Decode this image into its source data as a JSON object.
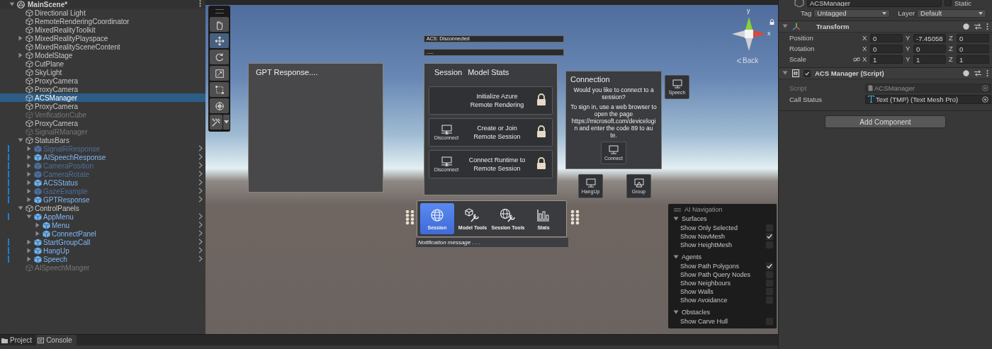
{
  "hierarchy": {
    "scene": {
      "label": "MainScene*",
      "expanded": true
    },
    "items": [
      {
        "label": "Directional Light",
        "kind": "object",
        "disabled": false,
        "selected": false
      },
      {
        "label": "RemoteRenderingCoordinator",
        "kind": "object",
        "disabled": false,
        "selected": false
      },
      {
        "label": "MixedRealityToolkit",
        "kind": "object",
        "disabled": false,
        "selected": false
      },
      {
        "label": "MixedRealityPlayspace",
        "kind": "object",
        "disabled": false,
        "selected": false,
        "expanded": false
      },
      {
        "label": "MixedRealitySceneContent",
        "kind": "object",
        "disabled": false,
        "selected": false
      },
      {
        "label": "ModelStage",
        "kind": "object",
        "disabled": false,
        "selected": false,
        "expanded": false
      },
      {
        "label": "CutPlane",
        "kind": "object",
        "disabled": false,
        "selected": false
      },
      {
        "label": "SkyLight",
        "kind": "object",
        "disabled": false,
        "selected": false
      },
      {
        "label": "ProxyCamera",
        "kind": "object",
        "disabled": false,
        "selected": false
      },
      {
        "label": "ProxyCamera",
        "kind": "object",
        "disabled": false,
        "selected": false
      },
      {
        "label": "ACSManager",
        "kind": "object",
        "disabled": false,
        "selected": true
      },
      {
        "label": "ProxyCamera",
        "kind": "object",
        "disabled": false,
        "selected": false
      },
      {
        "label": "VerificationCube",
        "kind": "object",
        "disabled": true,
        "selected": false
      },
      {
        "label": "ProxyCamera",
        "kind": "object",
        "disabled": false,
        "selected": false
      },
      {
        "label": "SignalRManager",
        "kind": "object",
        "disabled": true,
        "selected": false
      },
      {
        "label": "StatusBars",
        "kind": "object",
        "disabled": false,
        "selected": false,
        "expanded": true,
        "children": [
          {
            "label": "SignalRResponse",
            "kind": "prefab",
            "override": true,
            "disabled": true,
            "selected": false,
            "expanded": false
          },
          {
            "label": "AISpeechResponse",
            "kind": "prefab",
            "override": true,
            "disabled": false,
            "selected": false,
            "expanded": false
          },
          {
            "label": "CameraPosition",
            "kind": "prefab",
            "override": true,
            "disabled": true,
            "selected": false,
            "expanded": false
          },
          {
            "label": "CameraRotate",
            "kind": "prefab",
            "override": true,
            "disabled": true,
            "selected": false,
            "expanded": false
          },
          {
            "label": "ACSStatus",
            "kind": "prefab",
            "override": true,
            "disabled": false,
            "selected": false,
            "expanded": false
          },
          {
            "label": "GazeExample",
            "kind": "prefab",
            "override": true,
            "disabled": true,
            "selected": false,
            "expanded": false
          },
          {
            "label": "GPTResponse",
            "kind": "prefab",
            "override": true,
            "disabled": false,
            "selected": false,
            "expanded": false
          }
        ]
      },
      {
        "label": "ControlPanels",
        "kind": "object",
        "disabled": false,
        "selected": false,
        "expanded": true,
        "children": [
          {
            "label": "AppMenu",
            "kind": "prefab",
            "override": true,
            "disabled": false,
            "selected": false,
            "expanded": true,
            "children": [
              {
                "label": "Menu",
                "kind": "prefab",
                "override": false,
                "disabled": false,
                "selected": false,
                "expanded": false
              },
              {
                "label": "ConnectPanel",
                "kind": "prefab",
                "override": false,
                "disabled": false,
                "selected": false,
                "expanded": false
              }
            ]
          },
          {
            "label": "StartGroupCall",
            "kind": "prefab",
            "override": true,
            "disabled": false,
            "selected": false,
            "expanded": false
          },
          {
            "label": "HangUp",
            "kind": "prefab",
            "override": true,
            "disabled": false,
            "selected": false,
            "expanded": false
          },
          {
            "label": "Speech",
            "kind": "prefab",
            "override": true,
            "disabled": false,
            "selected": false,
            "expanded": false
          }
        ]
      },
      {
        "label": "AISpeechManger",
        "kind": "object",
        "disabled": true,
        "selected": false
      }
    ]
  },
  "scene": {
    "tools": [
      {
        "kind": "hand",
        "selected": false
      },
      {
        "kind": "move",
        "selected": true
      },
      {
        "kind": "rotate",
        "selected": false
      },
      {
        "kind": "scale",
        "selected": false
      },
      {
        "kind": "rect",
        "selected": false
      },
      {
        "kind": "transform",
        "selected": false
      },
      {
        "kind": "custom",
        "selected": false
      }
    ],
    "gizmo": {
      "y_label": "y",
      "x_label": "x",
      "back": "Back"
    },
    "status_bars": [
      "ACS: Disconnected",
      "....."
    ],
    "gpt_panel": {
      "title": "GPT Response...."
    },
    "session_panel": {
      "titles": [
        "Session",
        "Model Stats"
      ],
      "buttons": [
        {
          "lines": [
            "Initialize Azure",
            "Remote Rendering"
          ],
          "locked": true
        },
        {
          "lines": [
            "Create or Join",
            "Remote Session"
          ],
          "icon_label": "Disconnect",
          "locked": true
        },
        {
          "lines": [
            "Connect Runtime to",
            "Remote Session"
          ],
          "icon_label": "Disconnect",
          "locked": true
        }
      ]
    },
    "connection_panel": {
      "title": "Connection",
      "prompt": "Would you like to connect to a session?",
      "message": "To sign in, use a web browser to open the page https://microsoft.com/devicelogin and enter the code 89 to au te.",
      "button": "Connect"
    },
    "floating_buttons": [
      {
        "label": "Speech",
        "kind": "monitor"
      },
      {
        "label": "HangUp",
        "kind": "monitor"
      },
      {
        "label": "Group",
        "kind": "monitor-stand"
      }
    ],
    "app_menu": {
      "items": [
        {
          "label": "Session",
          "kind": "globe",
          "selected": true
        },
        {
          "label": "Model Tools",
          "kind": "cube-wrench",
          "selected": false
        },
        {
          "label": "Session Tools",
          "kind": "globe-wrench",
          "selected": false
        },
        {
          "label": "Stats",
          "kind": "chart",
          "selected": false
        }
      ],
      "notification": "Notification message . . ."
    },
    "ai_navigation": {
      "title": "AI Navigation",
      "sections": [
        {
          "title": "Surfaces",
          "expanded": true,
          "options": [
            {
              "label": "Show Only Selected",
              "checked": false
            },
            {
              "label": "Show NavMesh",
              "checked": true
            },
            {
              "label": "Show HeightMesh",
              "checked": false
            }
          ]
        },
        {
          "title": "Agents",
          "expanded": true,
          "options": [
            {
              "label": "Show Path Polygons",
              "checked": true
            },
            {
              "label": "Show Path Query Nodes",
              "checked": false
            },
            {
              "label": "Show Neighbours",
              "checked": false
            },
            {
              "label": "Show Walls",
              "checked": false
            },
            {
              "label": "Show Avoidance",
              "checked": false
            }
          ]
        },
        {
          "title": "Obstacles",
          "expanded": true,
          "options": [
            {
              "label": "Show Carve Hull",
              "checked": false
            }
          ]
        }
      ]
    }
  },
  "inspector": {
    "object": {
      "name": "ACSManager",
      "static_label": "Static",
      "static": false,
      "tag_label": "Tag",
      "tag": "Untagged",
      "layer_label": "Layer",
      "layer": "Default"
    },
    "components": [
      {
        "kind": "transform",
        "title": "Transform",
        "expanded": true,
        "rows": [
          {
            "label": "Position",
            "values": [
              {
                "axis": "X",
                "value": "0"
              },
              {
                "axis": "Y",
                "value": "-7.45058"
              },
              {
                "axis": "Z",
                "value": "0"
              }
            ]
          },
          {
            "label": "Rotation",
            "values": [
              {
                "axis": "X",
                "value": "0"
              },
              {
                "axis": "Y",
                "value": "0"
              },
              {
                "axis": "Z",
                "value": "0"
              }
            ]
          },
          {
            "label": "Scale",
            "linked": false,
            "values": [
              {
                "axis": "X",
                "value": "1"
              },
              {
                "axis": "Y",
                "value": "1"
              },
              {
                "axis": "Z",
                "value": "1"
              }
            ]
          }
        ]
      },
      {
        "kind": "script",
        "title": "ACS Manager (Script)",
        "enabled": true,
        "expanded": true,
        "fields": [
          {
            "label": "Script",
            "value": "ACSManager",
            "disabled": true,
            "kind": "script"
          },
          {
            "label": "Call Status",
            "value": "Text (TMP) (Text Mesh Pro)",
            "disabled": false,
            "kind": "text"
          }
        ]
      }
    ],
    "add_component": "Add Component"
  },
  "bottom_tabs": [
    {
      "label": "Project",
      "kind": "folder",
      "selected": false
    },
    {
      "label": "Console",
      "kind": "console",
      "selected": true
    }
  ]
}
